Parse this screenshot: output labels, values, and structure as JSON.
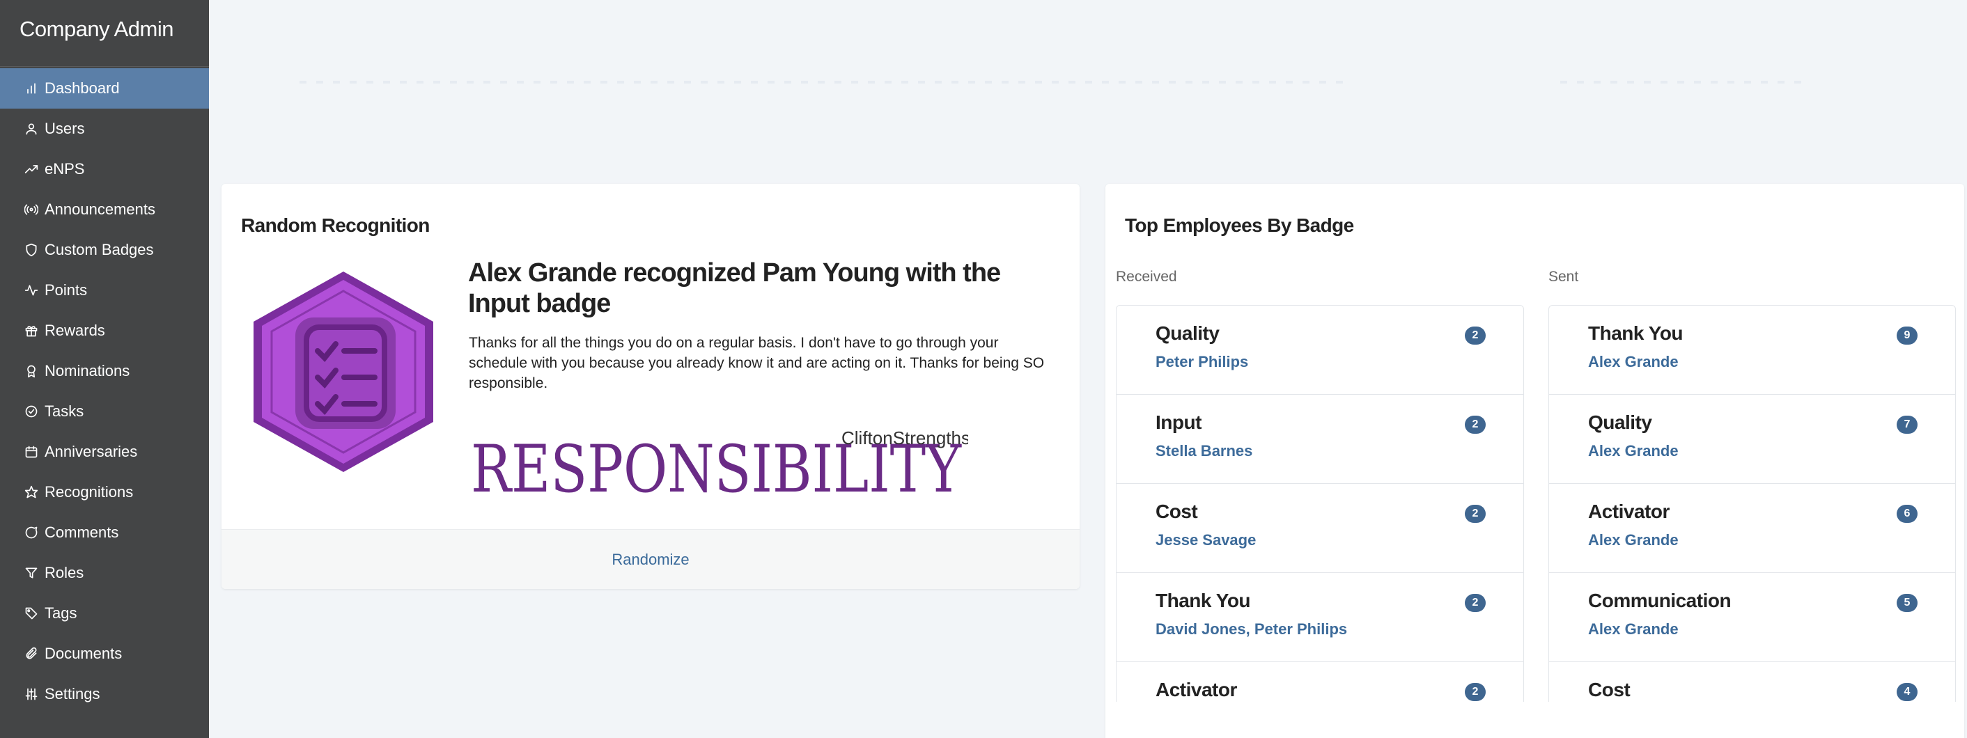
{
  "sidebar": {
    "brand": "Company Admin",
    "items": [
      {
        "label": "Dashboard",
        "icon": "bar-chart-icon",
        "active": true
      },
      {
        "label": "Users",
        "icon": "user-icon"
      },
      {
        "label": "eNPS",
        "icon": "trending-up-icon"
      },
      {
        "label": "Announcements",
        "icon": "broadcast-icon"
      },
      {
        "label": "Custom Badges",
        "icon": "shield-icon"
      },
      {
        "label": "Points",
        "icon": "activity-icon"
      },
      {
        "label": "Rewards",
        "icon": "gift-icon"
      },
      {
        "label": "Nominations",
        "icon": "award-icon"
      },
      {
        "label": "Tasks",
        "icon": "check-circle-icon"
      },
      {
        "label": "Anniversaries",
        "icon": "calendar-icon"
      },
      {
        "label": "Recognitions",
        "icon": "star-icon"
      },
      {
        "label": "Comments",
        "icon": "message-circle-icon"
      },
      {
        "label": "Roles",
        "icon": "filter-icon"
      },
      {
        "label": "Tags",
        "icon": "tag-icon"
      },
      {
        "label": "Documents",
        "icon": "paperclip-icon"
      },
      {
        "label": "Settings",
        "icon": "sliders-icon"
      }
    ]
  },
  "random_recognition": {
    "title": "Random Recognition",
    "heading": "Alex Grande recognized Pam Young with the Input badge",
    "message": "Thanks for all the things you do on a regular basis. I don't have to go through your schedule with you because you already know it and are acting on it. Thanks for being SO responsible.",
    "image_brand": "CliftonStrengths",
    "image_word": "RESPONSIBILITY",
    "randomize_label": "Randomize",
    "colors": {
      "badge_purple": "#b04fd6",
      "badge_dark": "#7a2a9c",
      "ink": "#6a2b86"
    }
  },
  "top_employees": {
    "title": "Top Employees By Badge",
    "received": {
      "label": "Received",
      "rows": [
        {
          "badge": "Quality",
          "count": "2",
          "people": [
            "Peter Philips"
          ]
        },
        {
          "badge": "Input",
          "count": "2",
          "people": [
            "Stella Barnes"
          ]
        },
        {
          "badge": "Cost",
          "count": "2",
          "people": [
            "Jesse Savage"
          ]
        },
        {
          "badge": "Thank You",
          "count": "2",
          "people": [
            "David Jones",
            "Peter Philips"
          ]
        },
        {
          "badge": "Activator",
          "count": "2",
          "people": []
        }
      ]
    },
    "sent": {
      "label": "Sent",
      "rows": [
        {
          "badge": "Thank You",
          "count": "9",
          "people": [
            "Alex Grande"
          ]
        },
        {
          "badge": "Quality",
          "count": "7",
          "people": [
            "Alex Grande"
          ]
        },
        {
          "badge": "Activator",
          "count": "6",
          "people": [
            "Alex Grande"
          ]
        },
        {
          "badge": "Communication",
          "count": "5",
          "people": [
            "Alex Grande"
          ]
        },
        {
          "badge": "Cost",
          "count": "4",
          "people": []
        }
      ]
    }
  },
  "colors": {
    "sidebar_bg": "#444546",
    "active_bg": "#5b7fa8",
    "link": "#3d6b9a",
    "pill": "#3f6690"
  }
}
